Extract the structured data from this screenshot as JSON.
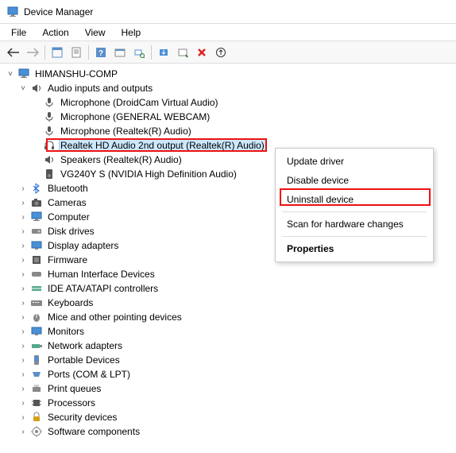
{
  "window": {
    "title": "Device Manager"
  },
  "menubar": {
    "file": "File",
    "action": "Action",
    "view": "View",
    "help": "Help"
  },
  "tree": {
    "root": "HIMANSHU-COMP",
    "audio": {
      "label": "Audio inputs and outputs",
      "children": [
        "Microphone (DroidCam Virtual Audio)",
        "Microphone (GENERAL WEBCAM)",
        "Microphone (Realtek(R) Audio)",
        "Realtek HD Audio 2nd output (Realtek(R) Audio)",
        "Speakers (Realtek(R) Audio)",
        "VG240Y S (NVIDIA High Definition Audio)"
      ]
    },
    "categories": [
      "Bluetooth",
      "Cameras",
      "Computer",
      "Disk drives",
      "Display adapters",
      "Firmware",
      "Human Interface Devices",
      "IDE ATA/ATAPI controllers",
      "Keyboards",
      "Mice and other pointing devices",
      "Monitors",
      "Network adapters",
      "Portable Devices",
      "Ports (COM & LPT)",
      "Print queues",
      "Processors",
      "Security devices",
      "Software components"
    ]
  },
  "context_menu": {
    "update": "Update driver",
    "disable": "Disable device",
    "uninstall": "Uninstall device",
    "scan": "Scan for hardware changes",
    "properties": "Properties"
  }
}
